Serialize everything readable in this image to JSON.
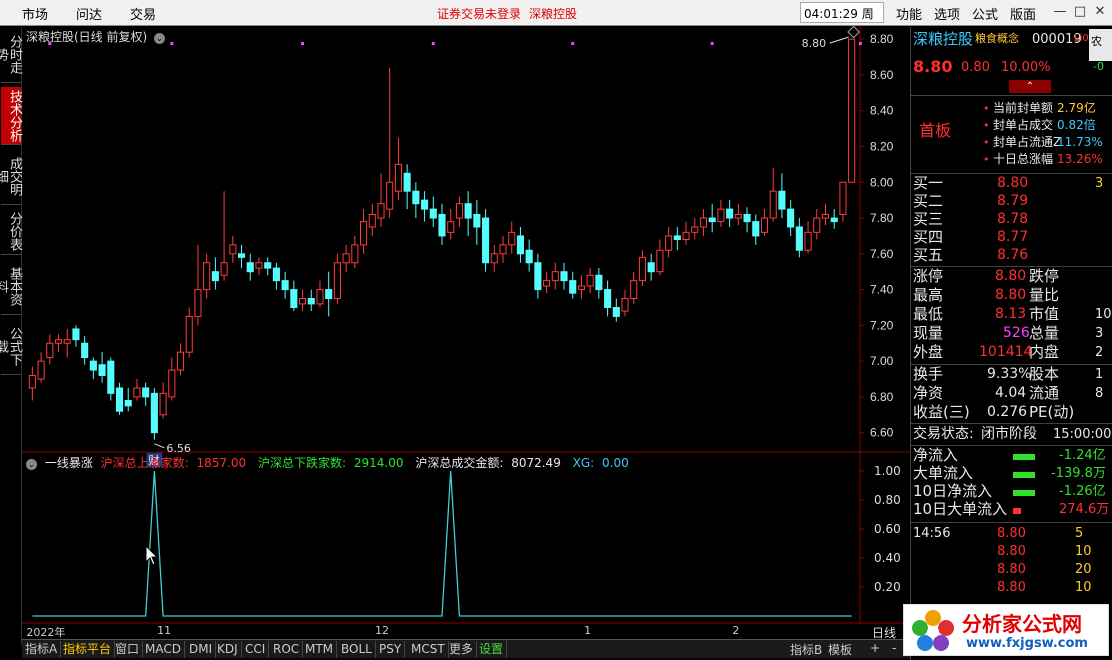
{
  "topbar": {
    "menu_left": [
      "市场",
      "问达",
      "交易"
    ],
    "notice": "证券交易未登录",
    "stock_name": "深粮控股",
    "clock": "04:01:29 周五",
    "menu_right": [
      "功能",
      "选项",
      "公式",
      "版面"
    ],
    "window_buttons": [
      "—",
      "□",
      "✕"
    ]
  },
  "left_tabs": [
    "分时走势",
    "技术分析",
    "成交明细",
    "分价表",
    "基本资料",
    "公式下载"
  ],
  "chart": {
    "title": "深粮控股(日线 前复权)",
    "price_labels": [
      "8.80",
      "8.60",
      "8.40",
      "8.20",
      "8.00",
      "7.80",
      "7.60",
      "7.40",
      "7.20",
      "7.00",
      "6.80",
      "6.60"
    ],
    "price_range": [
      6.52,
      8.84
    ],
    "high_marker": "8.80",
    "low_marker": "6.56",
    "low_badge": "财",
    "candles": [
      [
        6.85,
        6.92,
        6.97,
        6.78
      ],
      [
        6.9,
        7.0,
        7.05,
        6.88
      ],
      [
        7.02,
        7.1,
        7.15,
        6.98
      ],
      [
        7.1,
        7.12,
        7.15,
        7.05
      ],
      [
        7.1,
        7.12,
        7.18,
        7.02
      ],
      [
        7.18,
        7.12,
        7.2,
        7.08
      ],
      [
        7.1,
        7.02,
        7.14,
        6.98
      ],
      [
        7.0,
        6.95,
        7.02,
        6.9
      ],
      [
        6.98,
        6.92,
        7.05,
        6.88
      ],
      [
        7.0,
        6.82,
        7.02,
        6.78
      ],
      [
        6.85,
        6.72,
        6.88,
        6.7
      ],
      [
        6.78,
        6.75,
        6.85,
        6.72
      ],
      [
        6.8,
        6.85,
        6.9,
        6.78
      ],
      [
        6.85,
        6.8,
        6.88,
        6.75
      ],
      [
        6.82,
        6.6,
        6.85,
        6.56
      ],
      [
        6.7,
        6.82,
        6.88,
        6.68
      ],
      [
        6.8,
        6.95,
        7.02,
        6.78
      ],
      [
        6.95,
        7.05,
        7.1,
        6.92
      ],
      [
        7.05,
        7.25,
        7.3,
        7.02
      ],
      [
        7.25,
        7.4,
        7.65,
        7.2
      ],
      [
        7.4,
        7.55,
        7.6,
        7.35
      ],
      [
        7.5,
        7.45,
        7.58,
        7.4
      ],
      [
        7.48,
        7.55,
        7.95,
        7.45
      ],
      [
        7.6,
        7.65,
        7.7,
        7.55
      ],
      [
        7.6,
        7.58,
        7.65,
        7.52
      ],
      [
        7.55,
        7.5,
        7.6,
        7.45
      ],
      [
        7.52,
        7.55,
        7.58,
        7.48
      ],
      [
        7.55,
        7.52,
        7.58,
        7.48
      ],
      [
        7.52,
        7.45,
        7.55,
        7.4
      ],
      [
        7.45,
        7.4,
        7.5,
        7.35
      ],
      [
        7.4,
        7.3,
        7.45,
        7.28
      ],
      [
        7.32,
        7.35,
        7.4,
        7.28
      ],
      [
        7.35,
        7.32,
        7.4,
        7.28
      ],
      [
        7.32,
        7.4,
        7.45,
        7.3
      ],
      [
        7.4,
        7.35,
        7.5,
        7.25
      ],
      [
        7.35,
        7.55,
        7.6,
        7.32
      ],
      [
        7.55,
        7.6,
        7.65,
        7.5
      ],
      [
        7.55,
        7.65,
        7.7,
        7.52
      ],
      [
        7.65,
        7.78,
        7.85,
        7.6
      ],
      [
        7.75,
        7.82,
        7.88,
        7.7
      ],
      [
        7.8,
        7.88,
        8.05,
        7.75
      ],
      [
        7.85,
        8.0,
        8.64,
        7.8
      ],
      [
        7.95,
        8.1,
        8.25,
        7.9
      ],
      [
        8.05,
        7.95,
        8.1,
        7.85
      ],
      [
        7.95,
        7.88,
        8.0,
        7.8
      ],
      [
        7.9,
        7.85,
        7.95,
        7.78
      ],
      [
        7.85,
        7.8,
        7.92,
        7.75
      ],
      [
        7.82,
        7.7,
        7.88,
        7.65
      ],
      [
        7.72,
        7.78,
        7.85,
        7.68
      ],
      [
        7.8,
        7.88,
        7.92,
        7.75
      ],
      [
        7.88,
        7.8,
        7.95,
        7.7
      ],
      [
        7.82,
        7.75,
        7.9,
        7.65
      ],
      [
        7.8,
        7.55,
        7.85,
        7.5
      ],
      [
        7.55,
        7.6,
        7.65,
        7.5
      ],
      [
        7.6,
        7.65,
        7.7,
        7.55
      ],
      [
        7.65,
        7.72,
        7.78,
        7.6
      ],
      [
        7.7,
        7.6,
        7.75,
        7.55
      ],
      [
        7.62,
        7.55,
        7.68,
        7.5
      ],
      [
        7.55,
        7.4,
        7.6,
        7.35
      ],
      [
        7.42,
        7.45,
        7.5,
        7.38
      ],
      [
        7.45,
        7.5,
        7.55,
        7.4
      ],
      [
        7.5,
        7.45,
        7.55,
        7.4
      ],
      [
        7.45,
        7.38,
        7.5,
        7.35
      ],
      [
        7.4,
        7.42,
        7.48,
        7.35
      ],
      [
        7.42,
        7.48,
        7.52,
        7.38
      ],
      [
        7.48,
        7.4,
        7.52,
        7.35
      ],
      [
        7.4,
        7.3,
        7.45,
        7.25
      ],
      [
        7.3,
        7.25,
        7.35,
        7.22
      ],
      [
        7.28,
        7.35,
        7.4,
        7.25
      ],
      [
        7.35,
        7.45,
        7.5,
        7.32
      ],
      [
        7.45,
        7.58,
        7.62,
        7.42
      ],
      [
        7.55,
        7.5,
        7.6,
        7.45
      ],
      [
        7.5,
        7.62,
        7.68,
        7.48
      ],
      [
        7.62,
        7.7,
        7.75,
        7.58
      ],
      [
        7.7,
        7.68,
        7.75,
        7.62
      ],
      [
        7.68,
        7.72,
        7.78,
        7.65
      ],
      [
        7.72,
        7.75,
        7.8,
        7.68
      ],
      [
        7.75,
        7.8,
        7.85,
        7.7
      ],
      [
        7.8,
        7.78,
        7.88,
        7.72
      ],
      [
        7.78,
        7.85,
        7.9,
        7.75
      ],
      [
        7.85,
        7.8,
        7.9,
        7.75
      ],
      [
        7.8,
        7.82,
        7.88,
        7.76
      ],
      [
        7.82,
        7.78,
        7.86,
        7.72
      ],
      [
        7.78,
        7.7,
        7.82,
        7.65
      ],
      [
        7.72,
        7.8,
        7.85,
        7.7
      ],
      [
        7.8,
        7.95,
        8.08,
        7.78
      ],
      [
        7.95,
        7.85,
        8.05,
        7.8
      ],
      [
        7.85,
        7.75,
        7.9,
        7.7
      ],
      [
        7.75,
        7.62,
        7.8,
        7.58
      ],
      [
        7.62,
        7.72,
        7.78,
        7.6
      ],
      [
        7.72,
        7.8,
        7.85,
        7.68
      ],
      [
        7.8,
        7.82,
        7.88,
        7.76
      ],
      [
        7.8,
        7.78,
        7.85,
        7.74
      ],
      [
        7.82,
        8.0,
        8.0,
        7.78
      ],
      [
        8.0,
        8.8,
        8.8,
        8.13
      ]
    ],
    "markers_top": [
      2,
      16,
      31,
      46,
      62,
      78,
      95
    ]
  },
  "indicator": {
    "name": "一线暴涨",
    "items": [
      {
        "label": "沪深总上涨家数:",
        "value": "1857.00",
        "color": "#ff3030"
      },
      {
        "label": "沪深总下跌家数:",
        "value": "2914.00",
        "color": "#30e030"
      },
      {
        "label": "沪深总成交金额:",
        "value": "8072.49",
        "color": "#e8e8e8"
      },
      {
        "label": "XG:",
        "value": "0.00",
        "color": "#40c8ff"
      }
    ],
    "scale_labels": [
      "1.00",
      "0.80",
      "0.60",
      "0.40",
      "0.20"
    ],
    "spikes": [
      14,
      48
    ]
  },
  "datebar": {
    "labels": [
      {
        "text": "2022年",
        "i": 0
      },
      {
        "text": "11",
        "i": 15
      },
      {
        "text": "12",
        "i": 40
      },
      {
        "text": "1",
        "i": 64
      },
      {
        "text": "2",
        "i": 81
      }
    ],
    "period": "日线"
  },
  "bottom_tabs": [
    {
      "label": "指标A",
      "cls": ""
    },
    {
      "label": "指标平台",
      "cls": "active"
    },
    {
      "label": "窗口",
      "cls": ""
    },
    {
      "label": "MACD",
      "cls": ""
    },
    {
      "label": "DMI",
      "cls": ""
    },
    {
      "label": "KDJ",
      "cls": ""
    },
    {
      "label": "CCI",
      "cls": ""
    },
    {
      "label": "ROC",
      "cls": ""
    },
    {
      "label": "MTM",
      "cls": ""
    },
    {
      "label": "BOLL",
      "cls": ""
    },
    {
      "label": "PSY",
      "cls": ""
    },
    {
      "label": "MCST",
      "cls": ""
    },
    {
      "label": "更多",
      "cls": ""
    },
    {
      "label": "设置",
      "cls": "green"
    }
  ],
  "bottom_right_tabs": [
    "指标B",
    "模板",
    "+",
    "-"
  ],
  "panel": {
    "name": "深粮控股",
    "concept": "粮食概念",
    "code": "000019",
    "li": "Li0",
    "extra": "农",
    "price": "8.80",
    "change": "0.80",
    "pct": "10.00%",
    "extra2": "-0",
    "badge": "首板",
    "seal_rows": [
      {
        "label": "当前封单额",
        "value": "2.79亿",
        "color": "#ffcc33"
      },
      {
        "label": "封单占成交",
        "value": "0.82倍",
        "color": "#40c8ff"
      },
      {
        "label": "封单占流通Z",
        "value": "11.73%",
        "color": "#40c8ff"
      },
      {
        "label": "十日总涨幅",
        "value": "13.26%",
        "color": "#ff3030"
      }
    ],
    "bids": [
      {
        "label": "买一",
        "price": "8.80",
        "vol": "3"
      },
      {
        "label": "买二",
        "price": "8.79",
        "vol": ""
      },
      {
        "label": "买三",
        "price": "8.78",
        "vol": ""
      },
      {
        "label": "买四",
        "price": "8.77",
        "vol": ""
      },
      {
        "label": "买五",
        "price": "8.76",
        "vol": ""
      }
    ],
    "stats": [
      {
        "l1": "涨停",
        "v1": "8.80",
        "c1": "#ff3030",
        "l2": "跌停",
        "v2": ""
      },
      {
        "l1": "最高",
        "v1": "8.80",
        "c1": "#ff3030",
        "l2": "量比",
        "v2": ""
      },
      {
        "l1": "最低",
        "v1": "8.13",
        "c1": "#ff3030",
        "l2": "市值",
        "v2": "10"
      },
      {
        "l1": "现量",
        "v1": "526",
        "c1": "#ff40ff",
        "l2": "总量",
        "v2": "3"
      },
      {
        "l1": "外盘",
        "v1": "101414",
        "c1": "#ff3030",
        "l2": "内盘",
        "v2": "2"
      }
    ],
    "stats2": [
      {
        "l1": "换手",
        "v1": "9.33%",
        "l2": "股本",
        "v2": "1"
      },
      {
        "l1": "净资",
        "v1": "4.04",
        "l2": "流通",
        "v2": "8"
      },
      {
        "l1": "收益(三)",
        "v1": "0.276",
        "l2": "PE(动)",
        "v2": ""
      }
    ],
    "trade_state_label": "交易状态:",
    "trade_state": "闭市阶段",
    "trade_time": "15:00:00",
    "flows": [
      {
        "label": "净流入",
        "value": "-1.24亿",
        "color": "#30e030"
      },
      {
        "label": "大单流入",
        "value": "-139.8万",
        "color": "#30e030"
      },
      {
        "label": "10日净流入",
        "value": "-1.26亿",
        "color": "#30e030"
      },
      {
        "label": "10日大单流入",
        "value": "274.6万",
        "color": "#ff3030"
      }
    ],
    "ticks": [
      {
        "time": "14:56",
        "price": "8.80",
        "vol": "5"
      },
      {
        "time": "",
        "price": "8.80",
        "vol": "10"
      },
      {
        "time": "",
        "price": "8.80",
        "vol": "20"
      },
      {
        "time": "",
        "price": "8.80",
        "vol": "10"
      }
    ]
  },
  "watermark": {
    "title": "分析家公式网",
    "url": "www.fxjgsw.com"
  }
}
